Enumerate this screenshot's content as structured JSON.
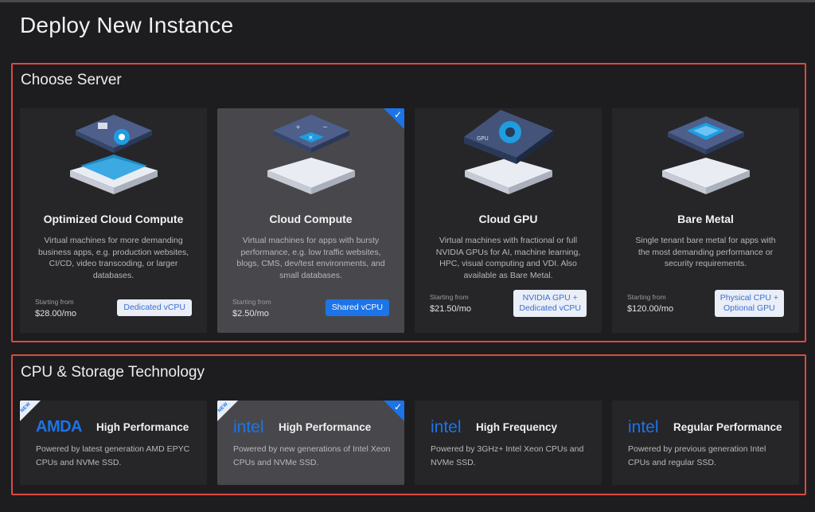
{
  "page": {
    "title": "Deploy New Instance"
  },
  "server_section": {
    "title": "Choose Server",
    "cards": [
      {
        "title": "Optimized Cloud Compute",
        "description": "Virtual machines for more demanding business apps, e.g. production websites, CI/CD, video transcoding, or larger databases.",
        "price_label": "Starting from",
        "price": "$28.00/mo",
        "badge_line1": "Dedicated vCPU",
        "badge_line2": "",
        "selected": false
      },
      {
        "title": "Cloud Compute",
        "description": "Virtual machines for apps with bursty performance, e.g. low traffic websites, blogs, CMS, dev/test environments, and small databases.",
        "price_label": "Starting from",
        "price": "$2.50/mo",
        "badge_line1": "Shared vCPU",
        "badge_line2": "",
        "selected": true
      },
      {
        "title": "Cloud GPU",
        "description": "Virtual machines with fractional or full NVIDIA GPUs for AI, machine learning, HPC, visual computing and VDI. Also available as Bare Metal.",
        "price_label": "Starting from",
        "price": "$21.50/mo",
        "badge_line1": "NVIDIA GPU +",
        "badge_line2": "Dedicated vCPU",
        "selected": false
      },
      {
        "title": "Bare Metal",
        "description": "Single tenant bare metal for apps with the most demanding performance or security requirements.",
        "price_label": "Starting from",
        "price": "$120.00/mo",
        "badge_line1": "Physical CPU +",
        "badge_line2": "Optional GPU",
        "selected": false
      }
    ]
  },
  "cpu_section": {
    "title": "CPU & Storage Technology",
    "cards": [
      {
        "brand": "AMDA",
        "title": "High Performance",
        "description": "Powered by latest generation AMD EPYC CPUs and NVMe SSD.",
        "new_label": "NEW",
        "selected": false
      },
      {
        "brand": "intel",
        "title": "High Performance",
        "description": "Powered by new generations of Intel Xeon CPUs and NVMe SSD.",
        "new_label": "NEW",
        "selected": true
      },
      {
        "brand": "intel",
        "title": "High Frequency",
        "description": "Powered by 3GHz+ Intel Xeon CPUs and NVMe SSD.",
        "new_label": "",
        "selected": false
      },
      {
        "brand": "intel",
        "title": "Regular Performance",
        "description": "Powered by previous generation Intel CPUs and regular SSD.",
        "new_label": "",
        "selected": false
      }
    ]
  },
  "colors": {
    "accent": "#1c74e8",
    "highlight_border": "#d94b43",
    "background": "#1d1d1f",
    "card": "#262629",
    "card_selected": "#48484c"
  },
  "icons": {
    "selected": "checkmark-icon"
  }
}
